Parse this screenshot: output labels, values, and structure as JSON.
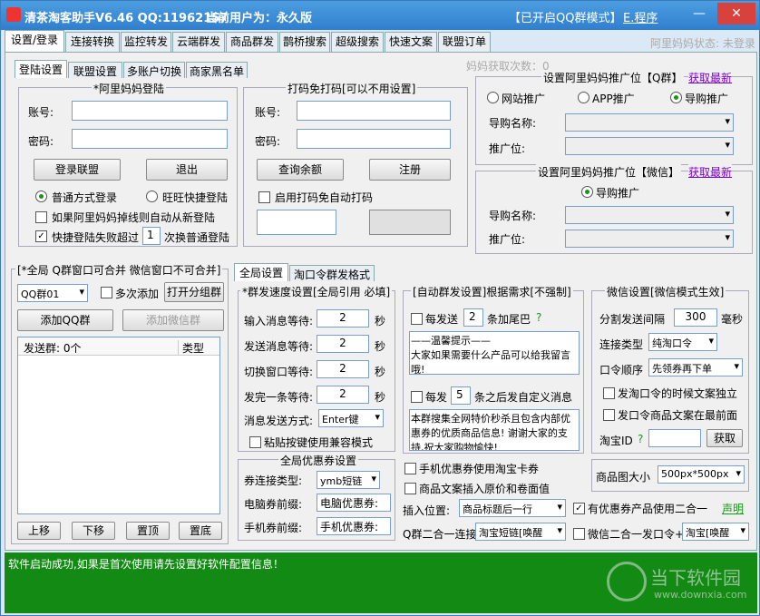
{
  "title": "清茶淘客助手V6.46 QQ:11962157",
  "user_label": "当前用户为：永久版",
  "mode": "【已开启QQ群模式】",
  "e_prog": "E.程序",
  "main_tabs": [
    "设置/登录",
    "连接转换",
    "监控转发",
    "云端群发",
    "商品群发",
    "鹊桥搜索",
    "超级搜索",
    "快速文案",
    "联盟订单"
  ],
  "alimama_state": "阿里妈妈状态: 未登录",
  "mama_count": "妈妈获取次数：0",
  "sub_tabs": [
    "登陆设置",
    "联盟设置",
    "多账户切换",
    "商家黑名单"
  ],
  "login": {
    "title": "*阿里妈妈登陆",
    "account": "账号:",
    "password": "密码:",
    "login_btn": "登录联盟",
    "logout_btn": "退出",
    "normal": "普通方式登录",
    "wangwang": "旺旺快捷登陆",
    "relogin": "如果阿里妈妈掉线则自动从新登陆",
    "fail_pre": "快捷登陆失败超过",
    "fail_n": "1",
    "fail_post": "次换普通登陆"
  },
  "captcha": {
    "title": "打码免打码[可以不用设置]",
    "account": "账号:",
    "password": "密码:",
    "query": "查询余额",
    "register": "注册",
    "auto": "启用打码免自动打码"
  },
  "promo_qq": {
    "title": "设置阿里妈妈推广位【Q群】",
    "get": "获取最新",
    "r1": "网站推广",
    "r2": "APP推广",
    "r3": "导购推广",
    "name": "导购名称:",
    "pos": "推广位:"
  },
  "promo_wx": {
    "title": "设置阿里妈妈推广位【微信】",
    "get": "获取最新",
    "r3": "导购推广",
    "name": "导购名称:",
    "pos": "推广位:"
  },
  "left": {
    "title": "[*全局 Q群窗口可合并 微信窗口不可合并]",
    "group_sel": "QQ群01",
    "multi": "多次添加",
    "open": "打开分组群",
    "add_qq": "添加QQ群",
    "add_wx": "添加微信群",
    "col1": "发送群: 0个",
    "col2": "类型",
    "up": "上移",
    "down": "下移",
    "top": "置顶",
    "bottom": "置底"
  },
  "lower_tabs": [
    "全局设置",
    "淘口令群发格式"
  ],
  "speed": {
    "title": "*群发速度设置[全局引用 必填]",
    "rows": [
      {
        "l": "输入消息等待:",
        "v": "2",
        "u": "秒"
      },
      {
        "l": "发送消息等待:",
        "v": "2",
        "u": "秒"
      },
      {
        "l": "切换窗口等待:",
        "v": "2",
        "u": "秒"
      },
      {
        "l": "发完一条等待:",
        "v": "2",
        "u": "秒"
      }
    ],
    "method": "消息发送方式:",
    "method_v": "Enter键",
    "paste": "粘贴按键使用兼容模式"
  },
  "coupon": {
    "title": "全局优惠券设置",
    "q": "?",
    "link_type": "券连接类型:",
    "link_v": "ymb短链",
    "pc": "电脑券前缀:",
    "pc_v": "电脑优惠券:",
    "mobile": "手机券前缀:",
    "mobile_v": "手机优惠券:"
  },
  "auto": {
    "title": "[自动群发设置]根据需求[不强制]",
    "each": "每发送",
    "n1": "2",
    "tail": "条加尾巴",
    "q": "?",
    "text1": "——温馨提示——\n大家如果需要什么产品可以给我留言哦!",
    "each2": "每发",
    "n2": "5",
    "custom": "条之后发自定义消息",
    "text2": "本群搜集全网特价秒杀且包含内部优惠券的优质商品信息! 谢谢大家的支持,祝大家购物愉快!"
  },
  "wechat": {
    "title": "微信设置[微信模式生效]",
    "interval": "分割发送间隔",
    "interval_v": "300",
    "ms": "毫秒",
    "conn": "连接类型",
    "conn_v": "纯淘口令",
    "order": "口令顺序",
    "order_v": "先领券再下单",
    "indep": "发淘口令的时候文案独立",
    "front": "发口令商品文案在最前面",
    "taobao_id": "淘宝ID",
    "get": "获取"
  },
  "misc": {
    "mobile_card": "手机优惠券使用淘宝卡券",
    "insert_price": "商品文案插入原价和卷面值",
    "insert_pos": "插入位置:",
    "insert_v": "商品标题后一行",
    "combine": "有优惠券产品使用二合一",
    "statement": "声明",
    "qq_link": "Q群二合一连接",
    "qq_link_v": "淘宝短链[唤醒",
    "wx_one": "微信二合一发口令+",
    "wx_v": "淘宝[唤醒",
    "img_size": "商品图大小",
    "img_v": "500px*500px"
  },
  "status": "软件启动成功,如果是首次使用请先设置好软件配置信息！",
  "watermark": "当下软件园",
  "watermark_url": "www.downxia.com"
}
